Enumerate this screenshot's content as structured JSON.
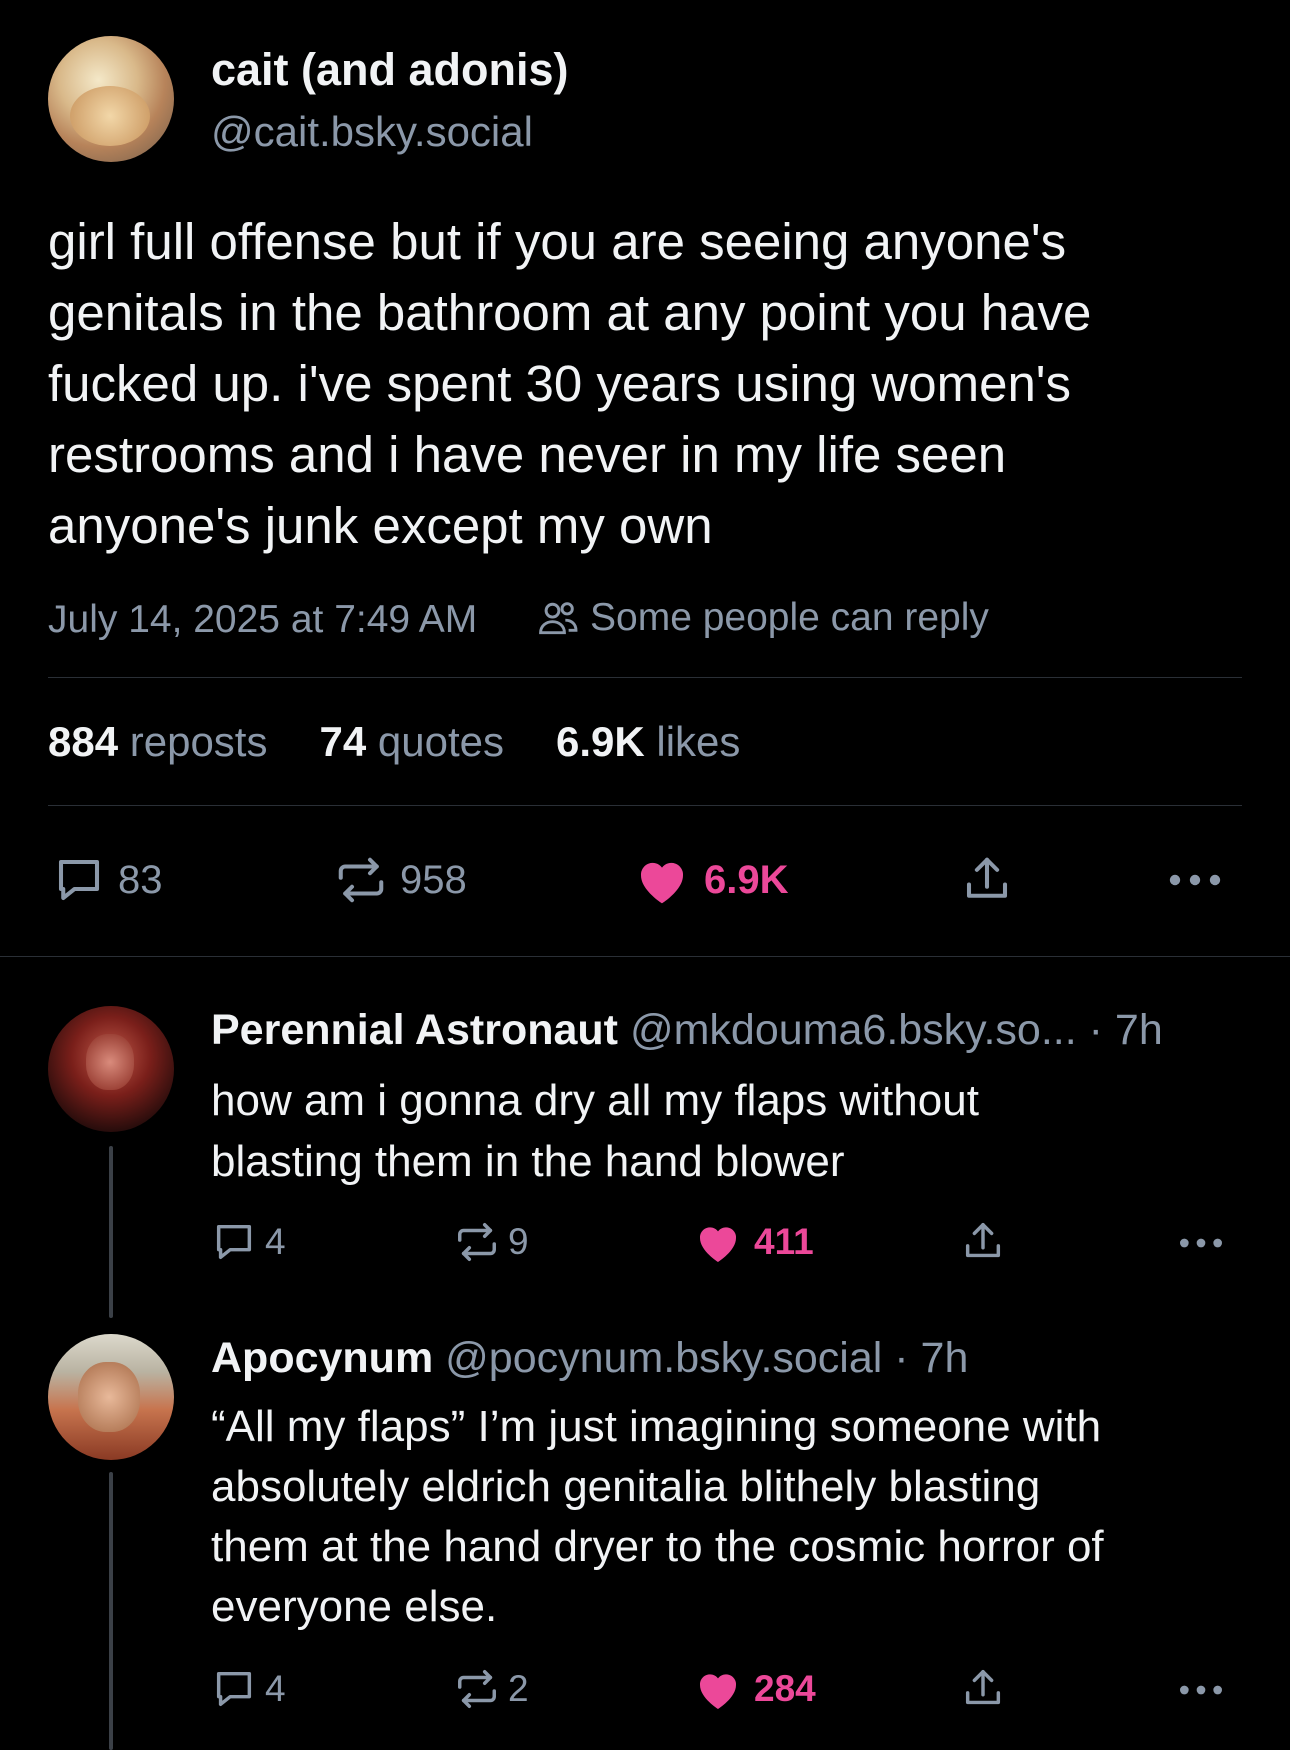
{
  "post": {
    "author_name": "cait (and adonis)",
    "author_handle": "@cait.bsky.social",
    "text_lines": [
      "girl full offense but if you are seeing anyone's",
      "genitals in the bathroom at any point you have",
      "fucked up. i've spent 30 years using women's",
      "restrooms and i have never in my life seen",
      "anyone's junk except my own"
    ],
    "timestamp": "July 14, 2025 at 7:49 AM",
    "reply_setting": "Some people can reply",
    "stats": {
      "reposts_count": "884",
      "reposts_label": "reposts",
      "quotes_count": "74",
      "quotes_label": "quotes",
      "likes_count": "6.9K",
      "likes_label": "likes"
    },
    "actions": {
      "replies": "83",
      "reposts": "958",
      "likes": "6.9K"
    }
  },
  "replies": [
    {
      "author_name": "Perennial Astronaut",
      "author_handle": "@mkdouma6.bsky.so...",
      "time": "· 7h",
      "text_lines": [
        "how am i gonna dry all my flaps without",
        "blasting them in the hand blower"
      ],
      "actions": {
        "replies": "4",
        "reposts": "9",
        "likes": "411"
      }
    },
    {
      "author_name": "Apocynum",
      "author_handle": "@pocynum.bsky.social",
      "time": "· 7h",
      "text_lines": [
        "“All my flaps” I’m just imagining someone with",
        "absolutely eldrich genitalia blithely blasting",
        "them at the hand dryer to the cosmic horror of",
        "everyone else."
      ],
      "actions": {
        "replies": "4",
        "reposts": "2",
        "likes": "284"
      }
    }
  ],
  "colors": {
    "background": "#000000",
    "text": "#f1f3f5",
    "muted": "#8b98a9",
    "like": "#ec4899",
    "divider": "#2a2f36"
  },
  "icons": [
    "reply-icon",
    "repost-icon",
    "heart-icon",
    "share-icon",
    "more-icon",
    "people-icon"
  ]
}
